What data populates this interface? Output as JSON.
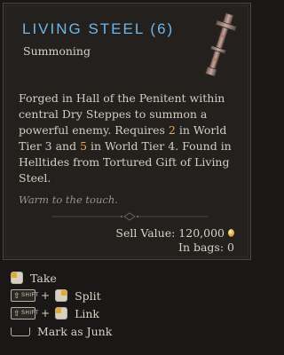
{
  "item": {
    "name": "LIVING STEEL (6)",
    "type": "Summoning",
    "icon": "living-steel-key-icon",
    "description_parts": [
      "Forged in Hall of the Penitent within central Dry Steppes to summon a powerful enemy. Requires ",
      "2",
      " in World Tier 3 and ",
      "5",
      " in World Tier 4. Found in Helltides from Tortured Gift of Living Steel."
    ],
    "flavor": "Warm to the touch.",
    "sell_label": "Sell Value: 120,000",
    "in_bags_label": "In bags: 0"
  },
  "actions": [
    {
      "keys": [
        "left-click"
      ],
      "label": "Take"
    },
    {
      "keys": [
        "shift",
        "right-click"
      ],
      "label": "Split"
    },
    {
      "keys": [
        "shift",
        "left-click"
      ],
      "label": "Link"
    },
    {
      "keys": [
        "spacebar"
      ],
      "label": "Mark as Junk"
    }
  ],
  "keycaps": {
    "shift": "SHIFT",
    "plus": "+"
  },
  "colors": {
    "title": "#6fb6ea",
    "highlight": "#f0a64a",
    "flavor": "#9a948a",
    "gold": "#d6a53a"
  }
}
